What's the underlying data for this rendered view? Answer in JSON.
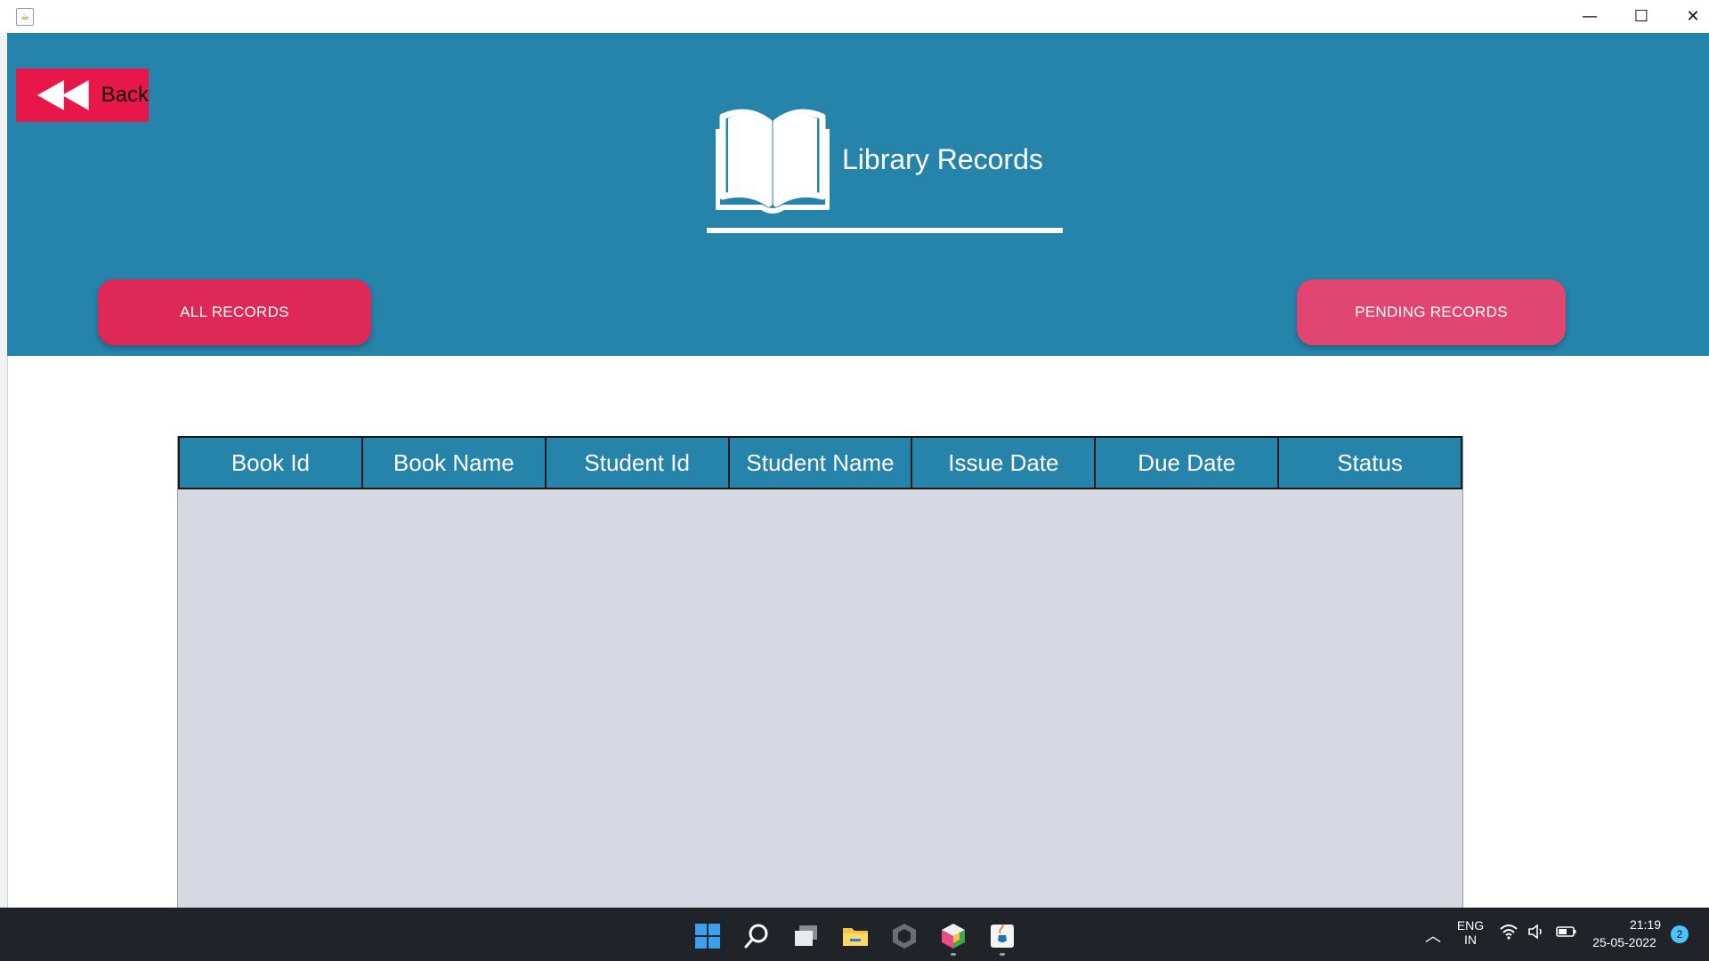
{
  "window": {
    "app_icon": "java-icon",
    "minimize_glyph": "—",
    "maximize_glyph": "☐",
    "close_glyph": "✕"
  },
  "header": {
    "back_label": "Back",
    "title": "Library Records",
    "book_icon": "open-book-icon",
    "background_color": "#2683aa"
  },
  "buttons": {
    "all_records": "ALL RECORDS",
    "pending_records": "PENDING RECORDS",
    "accent_color": "#e8174a"
  },
  "table": {
    "columns": [
      "Book Id",
      "Book Name",
      "Student Id",
      "Student Name",
      "Issue Date",
      "Due Date",
      "Status"
    ],
    "rows": []
  },
  "taskbar": {
    "apps": [
      "start-icon",
      "search-icon",
      "task-view-icon",
      "file-explorer-icon",
      "unity-icon",
      "netbeans-icon",
      "java-icon"
    ],
    "tray": {
      "language_line1": "ENG",
      "language_line2": "IN",
      "time": "21:19",
      "date": "25-05-2022",
      "notification_count": "2"
    }
  }
}
